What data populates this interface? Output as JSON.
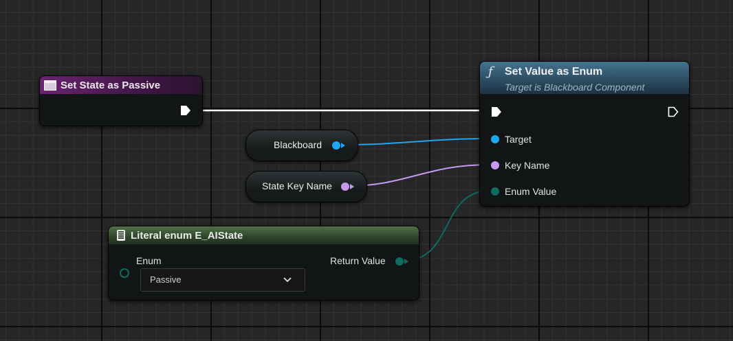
{
  "colors": {
    "exec": "#ffffff",
    "object_pin": "#1fa6f0",
    "name_pin": "#c79af2",
    "enum_pin": "#0d6b62",
    "event_header": "#5a1b5e",
    "function_header": "#3d6b87",
    "literal_header": "#3e5a36"
  },
  "nodes": {
    "set_state_passive": {
      "title": "Set State as Passive",
      "icon": "custom-event-icon"
    },
    "set_value_enum": {
      "title": "Set Value as Enum",
      "subtitle": "Target is Blackboard Component",
      "icon": "function-icon",
      "pins": {
        "target": "Target",
        "key_name": "Key Name",
        "enum_value": "Enum Value"
      }
    },
    "blackboard_var": {
      "label": "Blackboard"
    },
    "state_key_var": {
      "label": "State Key Name"
    },
    "literal_enum": {
      "title": "Literal enum E_AIState",
      "icon": "enum-literal-icon",
      "enum_label": "Enum",
      "return_label": "Return Value",
      "selected": "Passive"
    }
  }
}
